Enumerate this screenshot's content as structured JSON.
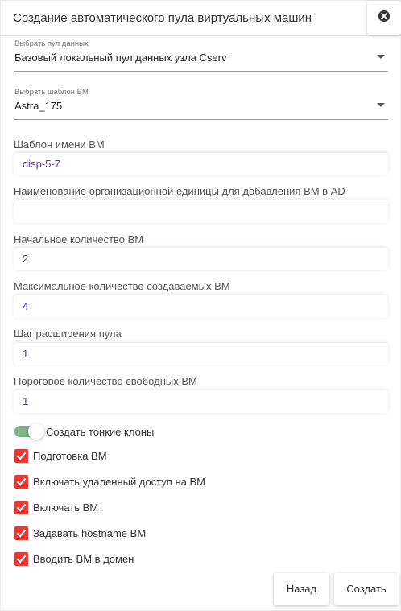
{
  "dialog": {
    "title": "Создание автоматического пула виртуальных машин"
  },
  "data_pool": {
    "label": "Выбрать пул данных",
    "value": "Базовый локальный пул данных узла Cserv"
  },
  "vm_template": {
    "label": "Выбрать шаблон ВМ",
    "value": "Astra_175"
  },
  "fields": {
    "name_template": {
      "label": "Шаблон имени ВМ",
      "value": "disp-5-7"
    },
    "ou_name": {
      "label": "Наименование организационной единицы для добавления ВМ в AD",
      "value": ""
    },
    "initial_count": {
      "label": "Начальное количество ВМ",
      "value": "2"
    },
    "max_count": {
      "label": "Максимальное количество создаваемых ВМ",
      "value": "4"
    },
    "expand_step": {
      "label": "Шаг расширения пула",
      "value": "1"
    },
    "free_threshold": {
      "label": "Пороговое количество свободных ВМ",
      "value": "1"
    }
  },
  "thin_clones": {
    "label": "Создать тонкие клоны",
    "enabled": true
  },
  "checkboxes": [
    {
      "label": "Подготовка ВМ",
      "checked": true
    },
    {
      "label": "Включать удаленный доступ на ВМ",
      "checked": true
    },
    {
      "label": "Включать ВМ",
      "checked": true
    },
    {
      "label": "Задавать hostname ВМ",
      "checked": true
    },
    {
      "label": "Вводить ВМ в домен",
      "checked": true
    }
  ],
  "buttons": {
    "back": "Назад",
    "create": "Создать"
  },
  "colors": {
    "checkbox": "#e53935",
    "toggle_track": "#7fb38a",
    "input_text": "#5b3b9a"
  }
}
